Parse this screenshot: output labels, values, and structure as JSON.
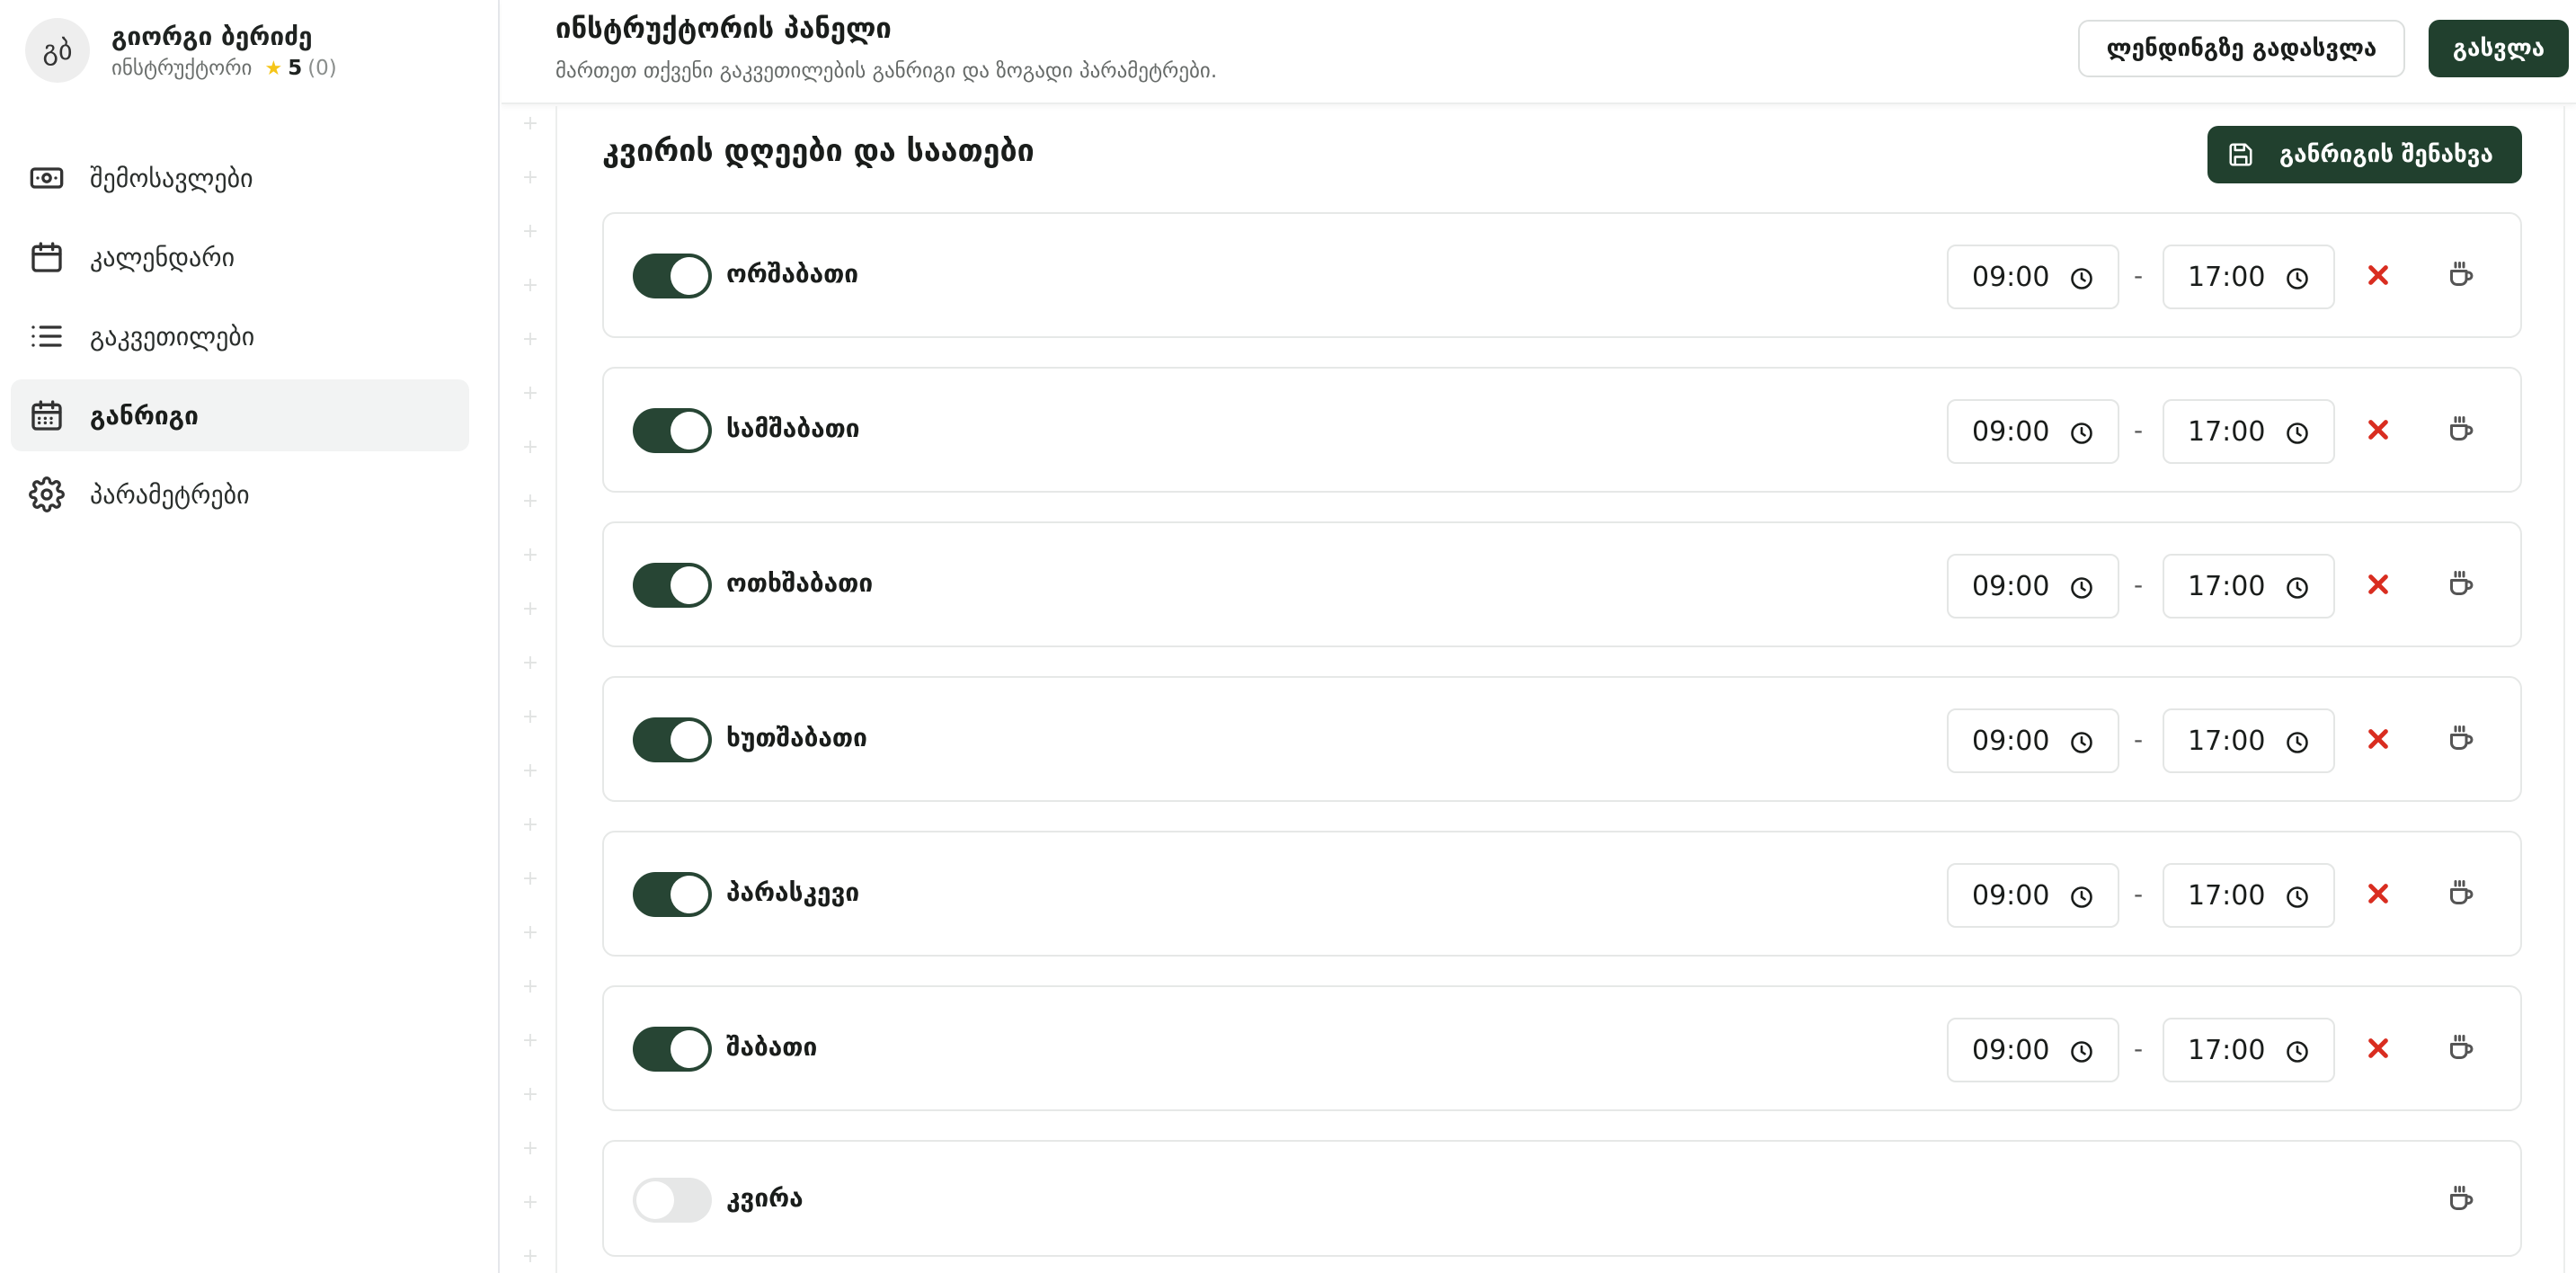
{
  "profile": {
    "initials": "გბ",
    "name": "გიორგი ბერიძე",
    "role": "ინსტრუქტორი",
    "rating": "5",
    "rating_count": "(0)"
  },
  "sidebar": {
    "items": [
      {
        "label": "შემოსავლები",
        "icon": "money-icon",
        "active": false
      },
      {
        "label": "კალენდარი",
        "icon": "calendar-icon",
        "active": false
      },
      {
        "label": "გაკვეთილები",
        "icon": "list-icon",
        "active": false
      },
      {
        "label": "განრიგი",
        "icon": "calendar-grid-icon",
        "active": true
      },
      {
        "label": "პარამეტრები",
        "icon": "gear-icon",
        "active": false
      }
    ]
  },
  "header": {
    "title": "ინსტრუქტორის პანელი",
    "subtitle": "მართეთ თქვენი გაკვეთილების განრიგი და ზოგადი პარამეტრები.",
    "landing_button": "ლენდინგზე გადასვლა",
    "logout_button": "გასვლა"
  },
  "schedule": {
    "title": "კვირის დღეები და საათები",
    "save_button": "განრიგის შენახვა",
    "separator": "-",
    "days": [
      {
        "name": "ორშაბათი",
        "enabled": true,
        "start": "09:00",
        "end": "17:00"
      },
      {
        "name": "სამშაბათი",
        "enabled": true,
        "start": "09:00",
        "end": "17:00"
      },
      {
        "name": "ოთხშაბათი",
        "enabled": true,
        "start": "09:00",
        "end": "17:00"
      },
      {
        "name": "ხუთშაბათი",
        "enabled": true,
        "start": "09:00",
        "end": "17:00"
      },
      {
        "name": "პარასკევი",
        "enabled": true,
        "start": "09:00",
        "end": "17:00"
      },
      {
        "name": "შაბათი",
        "enabled": true,
        "start": "09:00",
        "end": "17:00"
      },
      {
        "name": "კვირა",
        "enabled": false,
        "start": "",
        "end": ""
      }
    ]
  },
  "colors": {
    "accent": "#21402e",
    "toggle_on": "#274534",
    "remove": "#d92d20",
    "star": "#f5c518"
  }
}
